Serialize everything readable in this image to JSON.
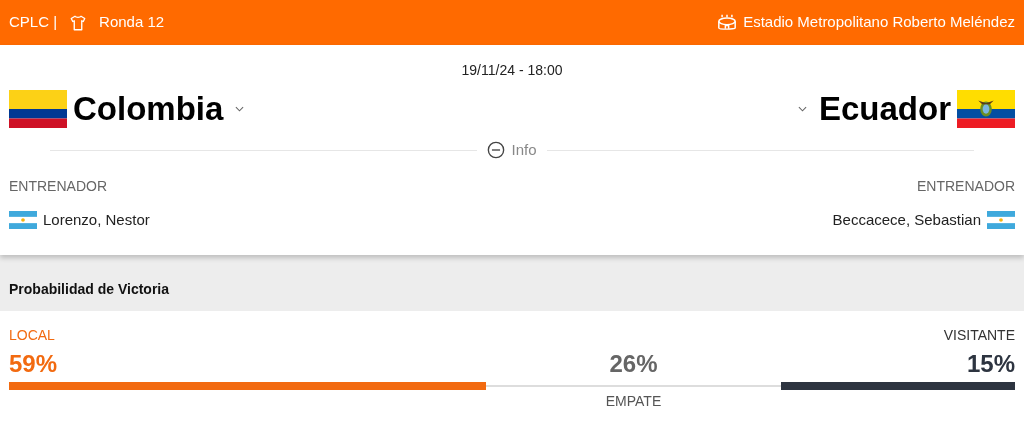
{
  "header": {
    "competition": "CPLC |",
    "round": "Ronda 12",
    "stadium": "Estadio Metropolitano Roberto Meléndez"
  },
  "match": {
    "datetime": "19/11/24 - 18:00",
    "home": {
      "name": "Colombia"
    },
    "away": {
      "name": "Ecuador"
    }
  },
  "info": {
    "label": "Info",
    "expanded": true
  },
  "coaches": [
    {
      "heading": "ENTRENADOR",
      "name": "Lorenzo, Nestor"
    },
    {
      "heading": "ENTRENADOR",
      "name": "Beccacece, Sebastian"
    }
  ],
  "probability": {
    "title": "Probabilidad de Victoria",
    "home": {
      "label": "LOCAL",
      "value": "59%"
    },
    "draw": {
      "label": "EMPATE",
      "value": "26%"
    },
    "away": {
      "label": "VISITANTE",
      "value": "15%"
    }
  }
}
